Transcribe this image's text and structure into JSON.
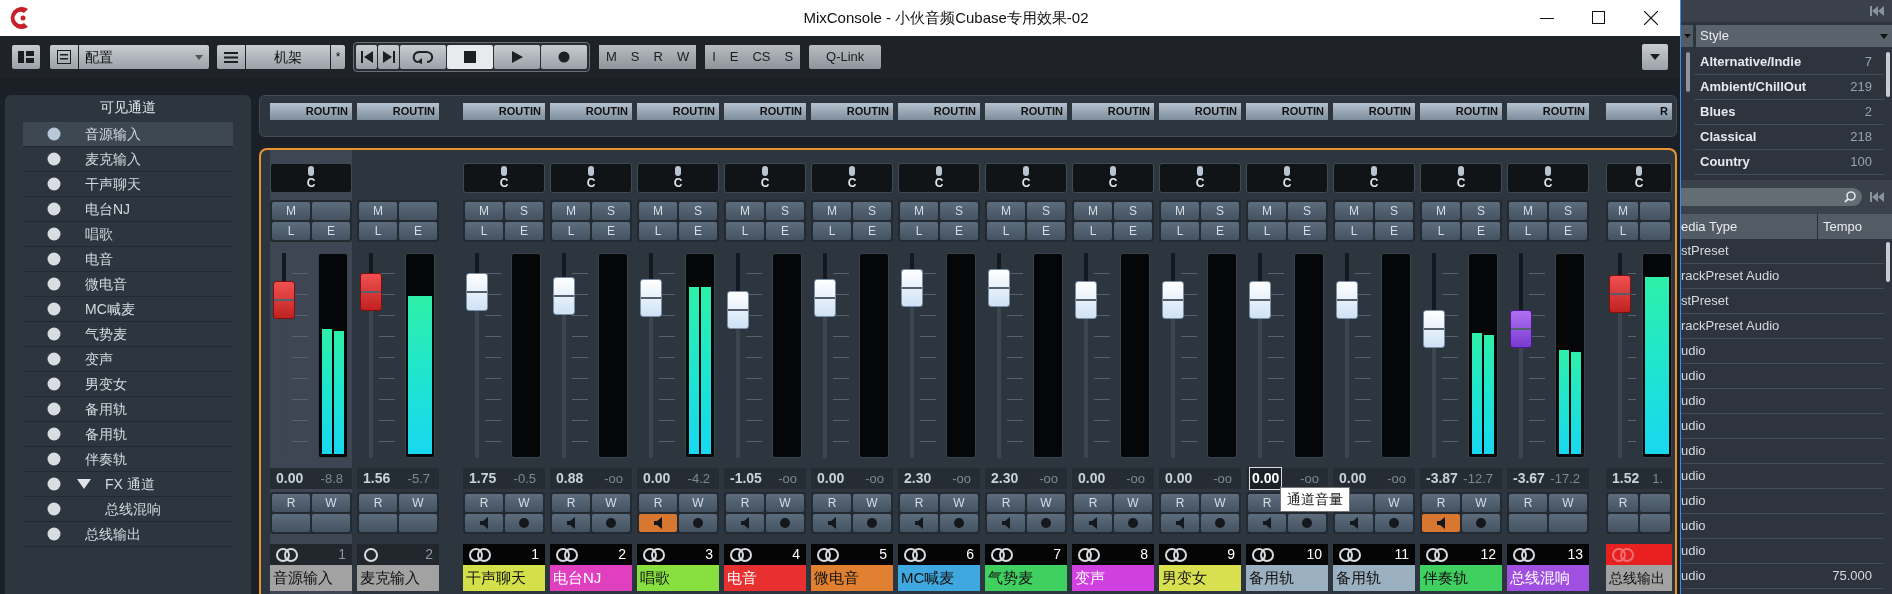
{
  "window": {
    "title": "MixConsole - 小伙音频Cubase专用效果-02"
  },
  "toolbar": {
    "config": "配置",
    "rack": "机架",
    "rack_mark": "*",
    "transport": [
      {
        "kind": "start",
        "active": false
      },
      {
        "kind": "end",
        "active": false
      },
      {
        "kind": "cycle",
        "active": false
      },
      {
        "kind": "stop",
        "active": true
      },
      {
        "kind": "play",
        "active": false
      },
      {
        "kind": "record",
        "active": false
      }
    ],
    "groups": [
      [
        "M",
        "S",
        "R",
        "W"
      ],
      [
        "I",
        "E",
        "CS",
        "S"
      ]
    ],
    "qlink": "Q-Link"
  },
  "visible_channels": {
    "title": "可见通道",
    "items": [
      {
        "label": "音源输入",
        "selected": true
      },
      {
        "label": "麦克输入",
        "selected": false
      },
      {
        "label": "干声聊天",
        "selected": false
      },
      {
        "label": "电台NJ",
        "selected": false
      },
      {
        "label": "唱歌",
        "selected": false
      },
      {
        "label": "电音",
        "selected": false
      },
      {
        "label": "微电音",
        "selected": false
      },
      {
        "label": "MC喊麦",
        "selected": false
      },
      {
        "label": "气势麦",
        "selected": false
      },
      {
        "label": "变声",
        "selected": false
      },
      {
        "label": "男变女",
        "selected": false
      },
      {
        "label": "备用轨",
        "selected": false
      },
      {
        "label": "备用轨",
        "selected": false
      },
      {
        "label": "伴奏轨",
        "selected": false
      },
      {
        "label": "FX 通道",
        "selected": false,
        "expanded": true,
        "children": [
          {
            "label": "总线混响",
            "selected": false
          }
        ]
      },
      {
        "label": "总线输出",
        "selected": false
      }
    ]
  },
  "strips": [
    {
      "kind": "input",
      "routing": "ROUTIN",
      "pan": "C",
      "top": {
        "m": "M",
        "l": "L",
        "e": "E"
      },
      "fader": {
        "level": 0.77
      },
      "meter": [
        {
          "level": 0.67
        },
        {
          "level": 0.66
        }
      ],
      "gain": "0.00",
      "peak": "-8.8",
      "focused": false,
      "rw": {
        "r": "R",
        "w": "W"
      },
      "link": {
        "kind": "stereo"
      },
      "number": "1",
      "label": "音源输入",
      "color": "#a2a2a2",
      "selected": true
    },
    {
      "kind": "input",
      "routing": "ROUTIN",
      "top": {
        "m": "M",
        "l": "L",
        "e": "E"
      },
      "fader": {
        "level": 0.81
      },
      "meter": [
        {
          "level": 0.85
        }
      ],
      "gain": "1.56",
      "peak": "-5.7",
      "focused": false,
      "rw": {
        "r": "R",
        "w": "W"
      },
      "link": {
        "kind": "mono"
      },
      "number": "2",
      "label": "麦克输入",
      "color": "#a2a2a2",
      "selected": false
    },
    {
      "kind": "audio",
      "routing": "ROUTIN",
      "pan": "C",
      "top": {
        "m": "M",
        "s": "S",
        "l": "L",
        "e": "E"
      },
      "fader": {
        "level": 0.81
      },
      "gain": "1.75",
      "peak": "-0.5",
      "focused": false,
      "rw": {
        "r": "R",
        "w": "W"
      },
      "monitor": {
        "listen": false
      },
      "link": {
        "kind": "stereo"
      },
      "number": "1",
      "label": "干声聊天",
      "color": "#d4e04a",
      "selected": false
    },
    {
      "kind": "audio",
      "routing": "ROUTIN",
      "pan": "C",
      "top": {
        "m": "M",
        "s": "S",
        "l": "L",
        "e": "E"
      },
      "fader": {
        "level": 0.79
      },
      "gain": "0.88",
      "peak": "-oo",
      "focused": false,
      "rw": {
        "r": "R",
        "w": "W"
      },
      "monitor": {
        "listen": false
      },
      "link": {
        "kind": "stereo"
      },
      "number": "2",
      "label": "电台NJ",
      "color": "#e040c0",
      "selected": false
    },
    {
      "kind": "audio",
      "routing": "ROUTIN",
      "pan": "C",
      "top": {
        "m": "M",
        "s": "S",
        "l": "L",
        "e": "E"
      },
      "fader": {
        "level": 0.78
      },
      "meter": [
        {
          "level": 0.9
        },
        {
          "level": 0.9
        }
      ],
      "gain": "0.00",
      "peak": "-4.2",
      "focused": false,
      "rw": {
        "r": "R",
        "w": "W"
      },
      "monitor": {
        "listen": true
      },
      "link": {
        "kind": "stereo"
      },
      "number": "3",
      "label": "唱歌",
      "color": "#88e040",
      "selected": false
    },
    {
      "kind": "audio",
      "routing": "ROUTIN",
      "pan": "C",
      "top": {
        "m": "M",
        "s": "S",
        "l": "L",
        "e": "E"
      },
      "fader": {
        "level": 0.72
      },
      "gain": "-1.05",
      "peak": "-oo",
      "focused": false,
      "rw": {
        "r": "R",
        "w": "W"
      },
      "monitor": {
        "listen": false
      },
      "link": {
        "kind": "stereo"
      },
      "number": "4",
      "label": "电音",
      "color": "#e83030",
      "selected": false
    },
    {
      "kind": "audio",
      "routing": "ROUTIN",
      "pan": "C",
      "top": {
        "m": "M",
        "s": "S",
        "l": "L",
        "e": "E"
      },
      "fader": {
        "level": 0.78
      },
      "gain": "0.00",
      "peak": "-oo",
      "focused": false,
      "rw": {
        "r": "R",
        "w": "W"
      },
      "monitor": {
        "listen": false
      },
      "link": {
        "kind": "stereo"
      },
      "number": "5",
      "label": "微电音",
      "color": "#e08030",
      "selected": false
    },
    {
      "kind": "audio",
      "routing": "ROUTIN",
      "pan": "C",
      "top": {
        "m": "M",
        "s": "S",
        "l": "L",
        "e": "E"
      },
      "fader": {
        "level": 0.83
      },
      "gain": "2.30",
      "peak": "-oo",
      "focused": false,
      "rw": {
        "r": "R",
        "w": "W"
      },
      "monitor": {
        "listen": false
      },
      "link": {
        "kind": "stereo"
      },
      "number": "6",
      "label": "MC喊麦",
      "color": "#40a8e0",
      "selected": false
    },
    {
      "kind": "audio",
      "routing": "ROUTIN",
      "pan": "C",
      "top": {
        "m": "M",
        "s": "S",
        "l": "L",
        "e": "E"
      },
      "fader": {
        "level": 0.83
      },
      "gain": "2.30",
      "peak": "-oo",
      "focused": false,
      "rw": {
        "r": "R",
        "w": "W"
      },
      "monitor": {
        "listen": false
      },
      "link": {
        "kind": "stereo"
      },
      "number": "7",
      "label": "气势麦",
      "color": "#40d060",
      "selected": false
    },
    {
      "kind": "audio",
      "routing": "ROUTIN",
      "pan": "C",
      "top": {
        "m": "M",
        "s": "S",
        "l": "L",
        "e": "E"
      },
      "fader": {
        "level": 0.77
      },
      "gain": "0.00",
      "peak": "-oo",
      "focused": false,
      "rw": {
        "r": "R",
        "w": "W"
      },
      "monitor": {
        "listen": false
      },
      "link": {
        "kind": "stereo"
      },
      "number": "8",
      "label": "变声",
      "color": "#d040e0",
      "selected": false
    },
    {
      "kind": "audio",
      "routing": "ROUTIN",
      "pan": "C",
      "top": {
        "m": "M",
        "s": "S",
        "l": "L",
        "e": "E"
      },
      "fader": {
        "level": 0.77
      },
      "gain": "0.00",
      "peak": "-oo",
      "focused": false,
      "rw": {
        "r": "R",
        "w": "W"
      },
      "monitor": {
        "listen": false
      },
      "link": {
        "kind": "stereo"
      },
      "number": "9",
      "label": "男变女",
      "color": "#d8e050",
      "selected": false
    },
    {
      "kind": "audio",
      "routing": "ROUTIN",
      "pan": "C",
      "top": {
        "m": "M",
        "s": "S",
        "l": "L",
        "e": "E"
      },
      "fader": {
        "level": 0.77
      },
      "gain": "0.00",
      "peak": "-oo",
      "focused": true,
      "rw": {
        "r": "R"
      },
      "monitor": {
        "listen": false
      },
      "link": {
        "kind": "stereo"
      },
      "number": "10",
      "label": "备用轨",
      "color": "#9ab0c0",
      "selected": false,
      "tooltip": "通道音量"
    },
    {
      "kind": "audio",
      "routing": "ROUTIN",
      "pan": "C",
      "top": {
        "m": "M",
        "s": "S",
        "l": "L",
        "e": "E"
      },
      "fader": {
        "level": 0.77
      },
      "gain": "0.00",
      "peak": "-oo",
      "focused": false,
      "rw": {
        "w": "W"
      },
      "monitor": {
        "listen": false
      },
      "link": {
        "kind": "stereo"
      },
      "number": "11",
      "label": "备用轨",
      "color": "#9ab0c0",
      "selected": false
    },
    {
      "kind": "audio",
      "routing": "ROUTIN",
      "pan": "C",
      "top": {
        "m": "M",
        "s": "S",
        "l": "L",
        "e": "E"
      },
      "fader": {
        "level": 0.63
      },
      "meter": [
        {
          "level": 0.65
        },
        {
          "level": 0.64
        }
      ],
      "gain": "-3.87",
      "peak": "-12.7",
      "focused": false,
      "rw": {
        "r": "R",
        "w": "W"
      },
      "monitor": {
        "listen": true
      },
      "link": {
        "kind": "stereo"
      },
      "number": "12",
      "label": "伴奏轨",
      "color": "#40d060",
      "selected": false
    },
    {
      "kind": "fx",
      "routing": "ROUTIN",
      "pan": "C",
      "top": {
        "m": "M",
        "s": "S",
        "l": "L",
        "e": "E"
      },
      "fader": {
        "level": 0.63
      },
      "meter": [
        {
          "level": 0.56
        },
        {
          "level": 0.55
        }
      ],
      "gain": "-3.67",
      "peak": "-17.2",
      "focused": false,
      "rw": {
        "r": "R",
        "w": "W"
      },
      "link": {
        "kind": "stereo"
      },
      "number": "13",
      "label": "总线混响",
      "color": "#a050e0",
      "selected": false
    },
    {
      "kind": "output",
      "routing": "R",
      "pan": "C",
      "top": {
        "m": "M",
        "l": "L"
      },
      "fader": {
        "level": 0.8
      },
      "meter": [
        {
          "level": 0.95
        }
      ],
      "gain": "1.52",
      "peak": "1.",
      "focused": false,
      "rw": {
        "r": "R"
      },
      "link": {
        "kind": "stereo"
      },
      "label": "总线输出",
      "color": "#a2a2a2",
      "selected": false
    }
  ],
  "media": {
    "filter": "Style",
    "styles": [
      {
        "name": "Alternative/Indie",
        "count": "7"
      },
      {
        "name": "Ambient/ChillOut",
        "count": "219"
      },
      {
        "name": "Blues",
        "count": "2"
      },
      {
        "name": "Classical",
        "count": "218"
      },
      {
        "name": "Country",
        "count": "100"
      }
    ],
    "columns": [
      "edia Type",
      "Tempo"
    ],
    "rows": [
      {
        "type": "stPreset"
      },
      {
        "type": "rackPreset Audio"
      },
      {
        "type": "stPreset"
      },
      {
        "type": "rackPreset Audio"
      },
      {
        "type": "udio"
      },
      {
        "type": "udio"
      },
      {
        "type": "udio"
      },
      {
        "type": "udio"
      },
      {
        "type": "udio"
      },
      {
        "type": "udio"
      },
      {
        "type": "udio"
      },
      {
        "type": "udio"
      },
      {
        "type": "udio"
      },
      {
        "type": "udio",
        "tempo": "75.000"
      }
    ]
  }
}
